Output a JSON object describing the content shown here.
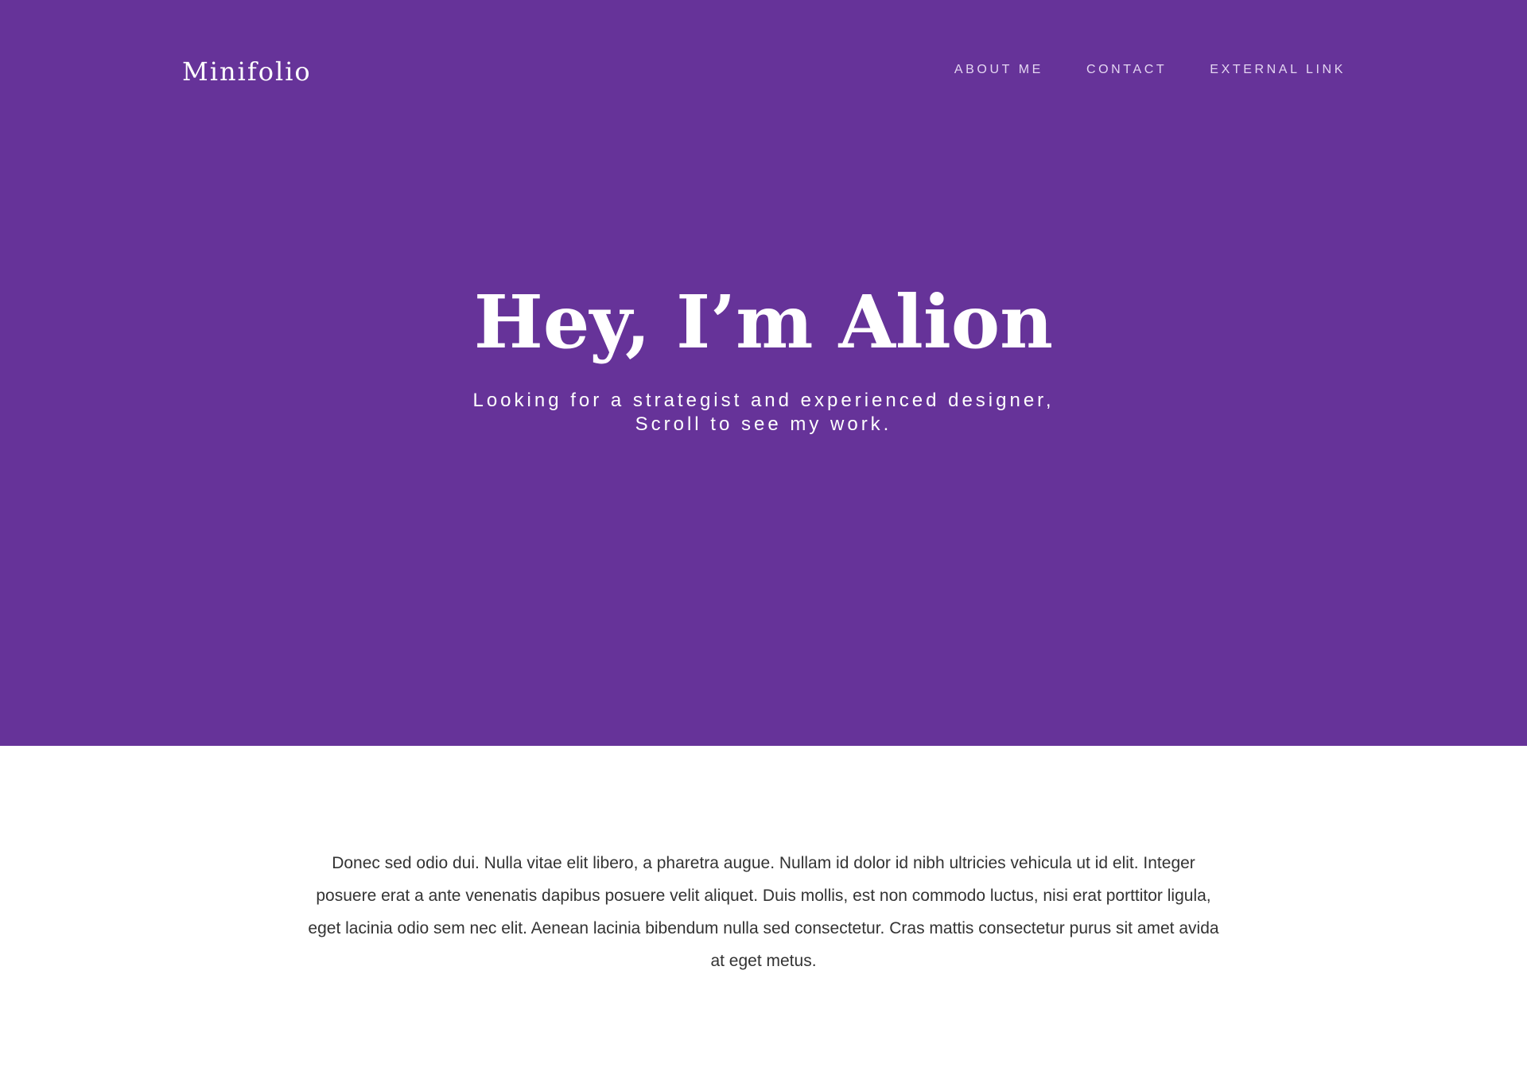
{
  "nav": {
    "brand": "Minifolio",
    "links": [
      {
        "label": "ABOUT ME"
      },
      {
        "label": "CONTACT"
      },
      {
        "label": "EXTERNAL LINK"
      }
    ]
  },
  "hero": {
    "title": "Hey, I’m Alion",
    "subtitle_line1": "Looking for a strategist and experienced designer,",
    "subtitle_line2": "Scroll to see my work."
  },
  "about": {
    "text": "Donec sed odio dui. Nulla vitae elit libero, a pharetra augue. Nullam id dolor id nibh ultricies vehicula ut id elit. Integer posuere erat a ante venenatis dapibus posuere velit aliquet. Duis mollis, est non commodo luctus, nisi erat porttitor ligula, eget lacinia odio sem nec elit. Aenean lacinia bibendum nulla sed consectetur. Cras mattis consectetur purus sit amet avida at eget metus."
  },
  "colors": {
    "hero_background": "#663399",
    "nav_link": "#e4d6f2",
    "body_text": "#333333"
  }
}
